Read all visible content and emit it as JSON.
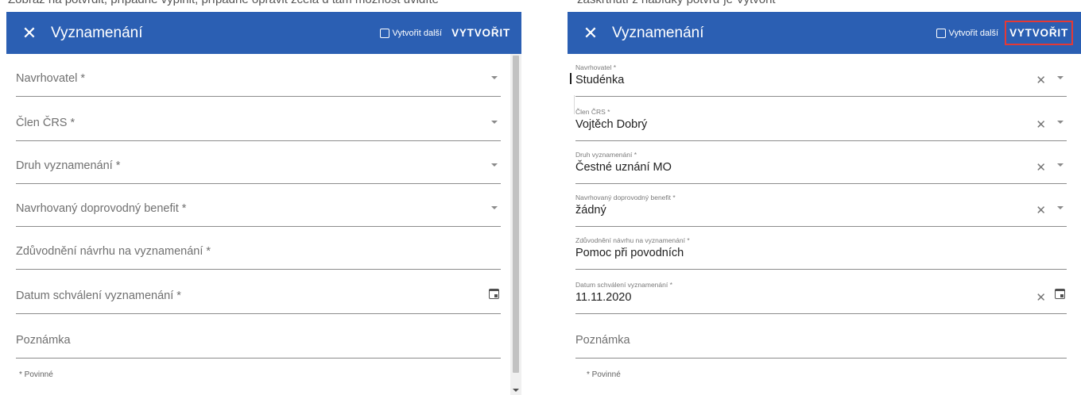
{
  "top_strip": {
    "left_fragment": "Zobraz   na potvrdit, případně vyplnit, případně opravit     zcela d    tam možnost   uvidíte",
    "right_fragment": "zaškrtnutí z  nabídky   potvrď   je    Vytvořit"
  },
  "dialog": {
    "title": "Vyznamenání",
    "close_glyph": "✕",
    "create_another_label": "Vytvořit další",
    "create_label": "VYTVOŘIT"
  },
  "left_form": {
    "fields": [
      {
        "placeholder": "Navrhovatel *"
      },
      {
        "placeholder": "Člen ČRS *"
      },
      {
        "placeholder": "Druh vyznamenání *"
      },
      {
        "placeholder": "Navrhovaný doprovodný benefit *"
      },
      {
        "placeholder": "Zdůvodnění návrhu na vyznamenání *"
      },
      {
        "placeholder": "Datum schválení vyznamenání *"
      },
      {
        "placeholder": "Poznámka"
      }
    ],
    "required_note": "* Povinné"
  },
  "right_form": {
    "fields": [
      {
        "label": "Navrhovatel *",
        "value": "Studénka"
      },
      {
        "label": "Člen ČRS *",
        "value": "Vojtěch Dobrý"
      },
      {
        "label": "Druh vyznamenání *",
        "value": "Čestné uznání MO"
      },
      {
        "label": "Navrhovaný doprovodný benefit *",
        "value": "žádný"
      },
      {
        "label": "Zdůvodnění návrhu na vyznamenání *",
        "value": "Pomoc při povodních"
      },
      {
        "label": "Datum schválení vyznamenání *",
        "value": "11.11.2020"
      },
      {
        "placeholder": "Poznámka"
      }
    ],
    "required_note": "* Povinné"
  },
  "icons": {
    "close": "close-icon",
    "checkbox": "checkbox-icon",
    "dropdown": "chevron-down-icon",
    "clear": "clear-icon",
    "calendar": "calendar-icon"
  },
  "colors": {
    "header": "#2b5fb3",
    "highlight": "#e53935"
  }
}
